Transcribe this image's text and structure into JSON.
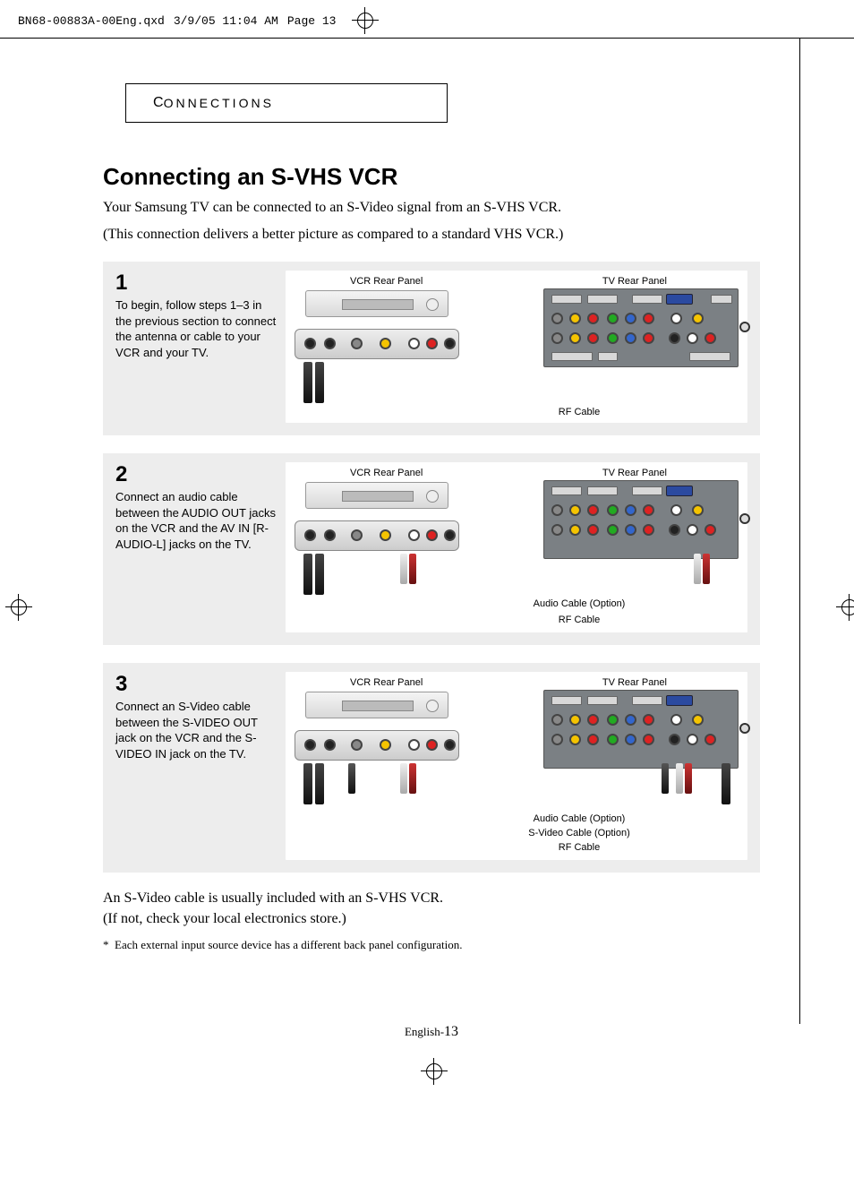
{
  "print_header": {
    "file": "BN68-00883A-00Eng.qxd",
    "datetime": "3/9/05 11:04 AM",
    "page": "Page 13"
  },
  "section_header": {
    "first_letter": "C",
    "rest": "ONNECTIONS"
  },
  "title": "Connecting an S-VHS VCR",
  "intro_line1": "Your Samsung TV can be connected to an S-Video signal from an S-VHS VCR.",
  "intro_line2": "(This connection delivers a better picture as compared to a standard VHS VCR.)",
  "steps": [
    {
      "num": "1",
      "text": "To begin, follow steps 1–3 in the previous section to connect the antenna or cable to your VCR and your TV.",
      "labels": {
        "vcr": "VCR Rear Panel",
        "tv": "TV Rear Panel",
        "cable1": "RF Cable"
      }
    },
    {
      "num": "2",
      "text": "Connect an audio cable between the AUDIO OUT jacks on the VCR and the AV IN [R-AUDIO-L] jacks on the TV.",
      "labels": {
        "vcr": "VCR Rear Panel",
        "tv": "TV Rear Panel",
        "cable1": "Audio Cable (Option)",
        "cable2": "RF Cable"
      }
    },
    {
      "num": "3",
      "text": "Connect an S-Video cable between the S-VIDEO OUT jack on the VCR and the S-VIDEO IN jack on the TV.",
      "labels": {
        "vcr": "VCR Rear Panel",
        "tv": "TV Rear Panel",
        "cable1": "Audio Cable (Option)",
        "cable2": "S-Video Cable (Option)",
        "cable3": "RF Cable"
      }
    }
  ],
  "post_line1": "An S-Video cable is usually included with an S-VHS VCR.",
  "post_line2": "(If not, check your local electronics store.)",
  "note": "Each external input source device has a different back panel configuration.",
  "asterisk": "*",
  "page_num_prefix": "English-",
  "page_num": "13"
}
